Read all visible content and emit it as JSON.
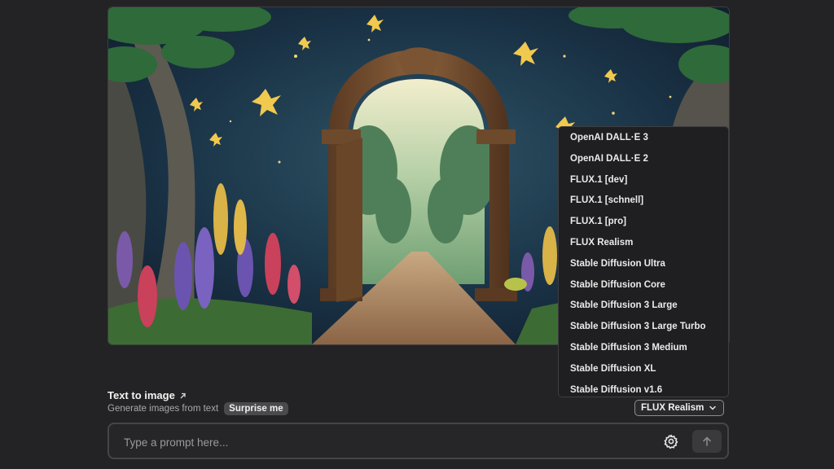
{
  "header": {
    "title": "Text to image",
    "subtitle": "Generate images from text",
    "surprise_label": "Surprise me"
  },
  "model_select": {
    "selected": "FLUX Realism",
    "options": [
      "OpenAI DALL·E 3",
      "OpenAI DALL·E 2",
      "FLUX.1 [dev]",
      "FLUX.1 [schnell]",
      "FLUX.1 [pro]",
      "FLUX Realism",
      "Stable Diffusion Ultra",
      "Stable Diffusion Core",
      "Stable Diffusion 3 Large",
      "Stable Diffusion 3 Large Turbo",
      "Stable Diffusion 3 Medium",
      "Stable Diffusion XL",
      "Stable Diffusion v1.6"
    ]
  },
  "prompt": {
    "placeholder": "Type a prompt here...",
    "value": ""
  },
  "icons": {
    "title_icon": "external-link-icon",
    "select_icon": "chevron-down-icon",
    "settings_icon": "gear-icon",
    "send_icon": "arrow-up-icon"
  },
  "colors": {
    "background": "#232325",
    "dropdown_bg": "#1f1f21",
    "badge_bg": "#4a4a4e"
  }
}
